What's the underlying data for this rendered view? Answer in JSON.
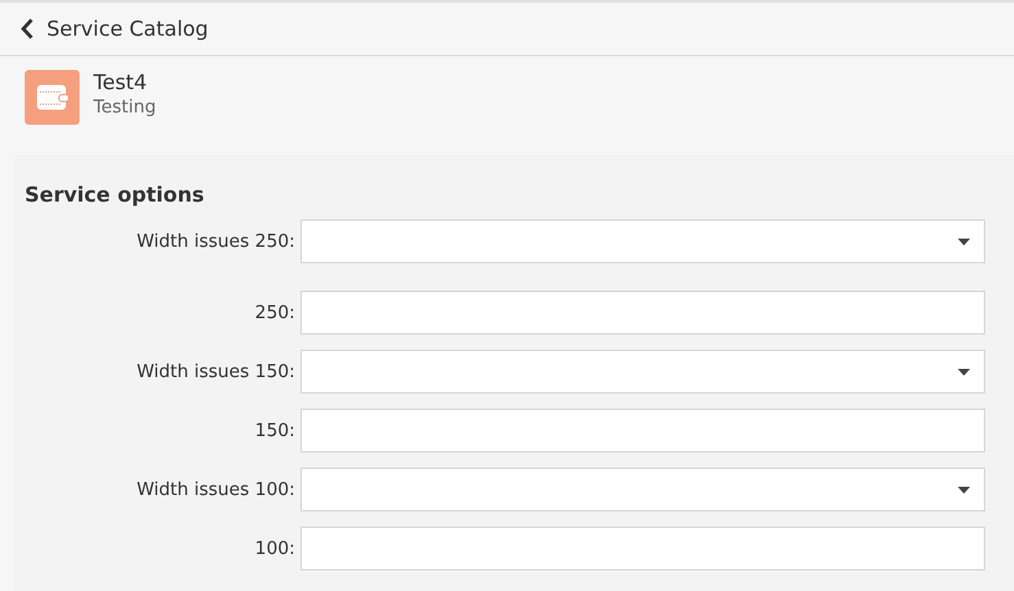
{
  "header": {
    "back_label": "Service Catalog"
  },
  "service": {
    "name": "Test4",
    "category": "Testing"
  },
  "section": {
    "title": "Service options"
  },
  "fields": [
    {
      "kind": "select",
      "label": "Width issues 250:"
    },
    {
      "kind": "text",
      "label": "250:"
    },
    {
      "kind": "select",
      "label": "Width issues 150:"
    },
    {
      "kind": "text",
      "label": "150:"
    },
    {
      "kind": "select",
      "label": "Width issues 100:"
    },
    {
      "kind": "text",
      "label": "100:"
    }
  ]
}
